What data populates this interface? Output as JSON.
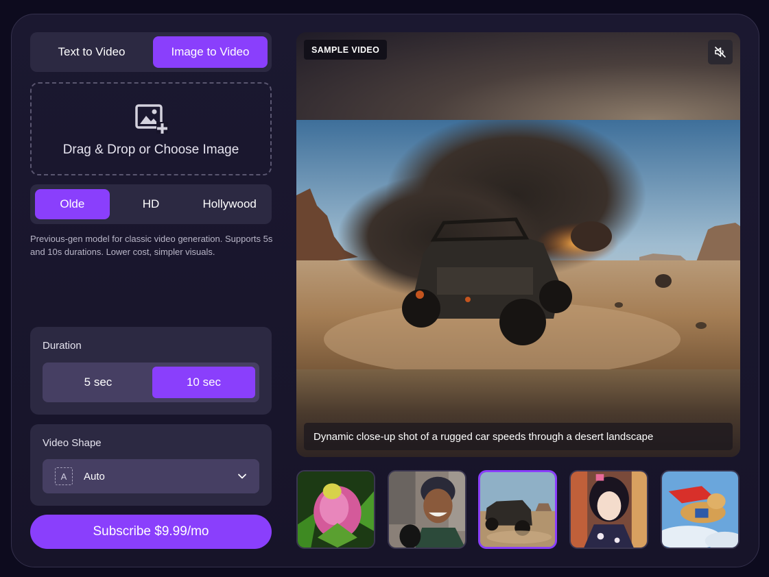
{
  "mode_tabs": [
    {
      "label": "Text to Video",
      "active": false
    },
    {
      "label": "Image to Video",
      "active": true
    }
  ],
  "dropzone": {
    "label": "Drag & Drop or Choose Image",
    "icon": "image-add-icon"
  },
  "model_tabs": [
    {
      "label": "Olde",
      "active": true
    },
    {
      "label": "HD",
      "active": false
    },
    {
      "label": "Hollywood",
      "active": false
    }
  ],
  "model_description": "Previous-gen model for classic video generation. Supports 5s and 10s durations. Lower cost, simpler visuals.",
  "duration": {
    "title": "Duration",
    "options": [
      {
        "label": "5 sec",
        "active": false
      },
      {
        "label": "10 sec",
        "active": true
      }
    ]
  },
  "video_shape": {
    "title": "Video Shape",
    "icon_letter": "A",
    "value": "Auto",
    "chevron_icon": "chevron-down-icon"
  },
  "subscribe_label": "Subscribe $9.99/mo",
  "video": {
    "badge": "SAMPLE VIDEO",
    "mute_icon": "volume-mute-icon",
    "caption": "Dynamic close-up shot of a rugged car speeds through a desert landscape"
  },
  "thumbnails": [
    {
      "subject": "pink flower bud with dew",
      "active": false
    },
    {
      "subject": "smiling woman on city street",
      "active": false
    },
    {
      "subject": "off-road car in desert",
      "active": true
    },
    {
      "subject": "anime girl in kimono",
      "active": false
    },
    {
      "subject": "dog flying with red cape",
      "active": false
    }
  ],
  "colors": {
    "accent": "#8a3ffc",
    "panel": "#2c2942",
    "background": "#0d0b1e"
  }
}
